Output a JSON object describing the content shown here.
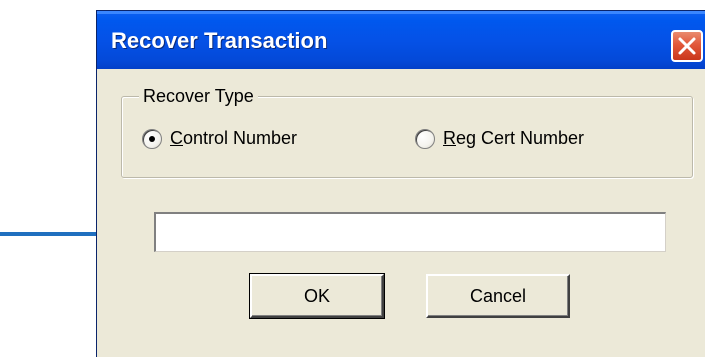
{
  "window": {
    "title": "Recover Transaction"
  },
  "group": {
    "legend": "Recover Type",
    "options": [
      {
        "label": "Control Number",
        "checked": true
      },
      {
        "label": "Reg Cert Number",
        "checked": false
      }
    ]
  },
  "input": {
    "value": ""
  },
  "buttons": {
    "ok_label": "OK",
    "cancel_label": "Cancel"
  },
  "icons": {
    "close": "close-icon",
    "annotation": "arrow-right-icon"
  },
  "colors": {
    "titlebar": "#0551e6",
    "close_button": "#e2583a",
    "dialog_bg": "#ece9d8",
    "annotation_arrow": "#1f6fbf"
  }
}
